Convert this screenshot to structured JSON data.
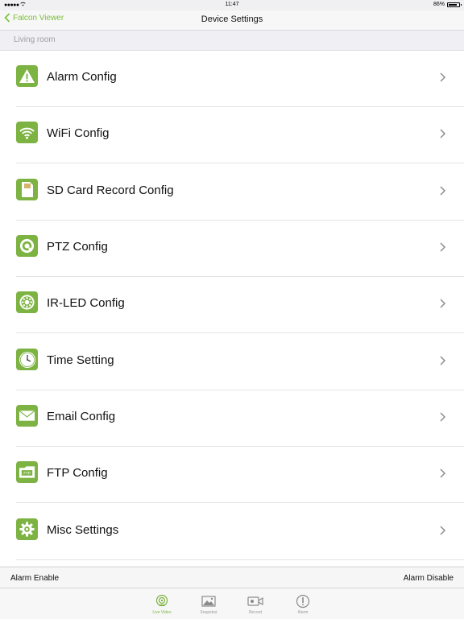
{
  "status_bar": {
    "signal": "●●●●● ",
    "time": "11:47",
    "battery": "86%",
    "battery_level": 0.86
  },
  "nav": {
    "back_label": "Falcon Viewer",
    "title": "Device Settings"
  },
  "section": {
    "header": "Living room"
  },
  "settings": [
    {
      "label": "Alarm Config",
      "icon": "alarm-warning-icon"
    },
    {
      "label": "WiFi Config",
      "icon": "wifi-icon"
    },
    {
      "label": "SD Card Record Config",
      "icon": "sd-card-icon"
    },
    {
      "label": "PTZ Config",
      "icon": "ptz-icon"
    },
    {
      "label": "IR-LED Config",
      "icon": "ir-led-icon"
    },
    {
      "label": "Time Setting",
      "icon": "clock-icon"
    },
    {
      "label": "Email Config",
      "icon": "email-icon"
    },
    {
      "label": "FTP Config",
      "icon": "ftp-icon"
    },
    {
      "label": "Misc Settings",
      "icon": "gear-icon"
    }
  ],
  "alarm_bar": {
    "enable_label": "Alarm Enable",
    "disable_label": "Alarm Disable"
  },
  "tabs": [
    {
      "label": "Live Video",
      "icon": "live-video-icon",
      "active": true
    },
    {
      "label": "Snapshot",
      "icon": "snapshot-icon",
      "active": false
    },
    {
      "label": "Record",
      "icon": "record-icon",
      "active": false
    },
    {
      "label": "Alarm",
      "icon": "alarm-tab-icon",
      "active": false
    }
  ],
  "colors": {
    "accent": "#7cb342",
    "back_link": "#7bbf3a",
    "inactive_tab": "#9a9a9a"
  }
}
